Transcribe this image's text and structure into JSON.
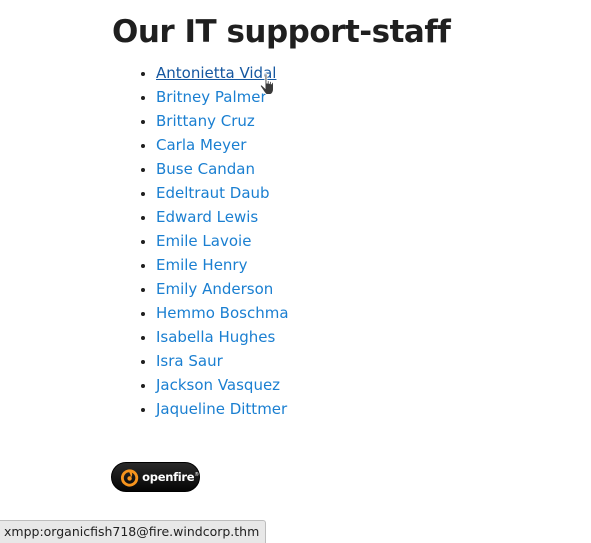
{
  "page": {
    "title": "Our IT support-staff"
  },
  "staff": [
    "Antonietta Vidal",
    "Britney Palmer",
    "Brittany Cruz",
    "Carla Meyer",
    "Buse Candan",
    "Edeltraut Daub",
    "Edward Lewis",
    "Emile Lavoie",
    "Emile Henry",
    "Emily Anderson",
    "Hemmo Boschma",
    "Isabella Hughes",
    "Isra Saur",
    "Jackson Vasquez",
    "Jaqueline Dittmer"
  ],
  "hovered_index": 0,
  "footer": {
    "badge_text": "openfire",
    "badge_mark": "®",
    "badge_icon": "openfire-flame-icon"
  },
  "status_bar": {
    "text": "xmpp:organicfish718@fire.windcorp.thm"
  },
  "colors": {
    "link": "#1a7fd1",
    "link_hover": "#1557a0",
    "heading": "#1f1f1f",
    "badge_bg": "#111111",
    "flame": "#f7941d"
  }
}
